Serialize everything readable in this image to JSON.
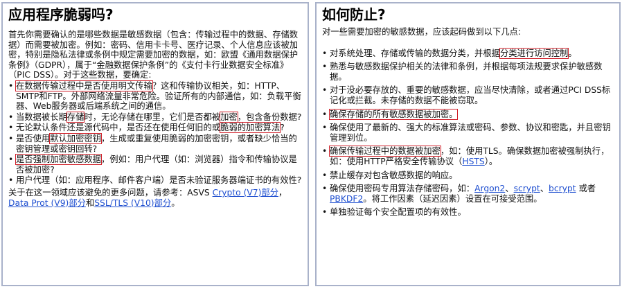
{
  "left": {
    "title": "应用程序脆弱吗?",
    "intro": "首先你需要确认的是哪些数据是敏感数据（包含：传输过程中的数据、存储数据）而需要被加密。例如：密码、信用卡卡号、医疗记录、个人信息应该被加密，特别是隐私法律或条例中规定需要加密的数据，如：欧盟《通用数据保护条例》（GDPR），属于“金融数据保护条例”的《支付卡行业数据安全标准》（PIC DSS）。对于这些数据，要确定:",
    "items": [
      {
        "pre": "",
        "box": "在数据传输过程中是否使用明文传输",
        "post": "？这和传输协议相关，如：HTTP、SMTP和FTP。外部网络流量非常危险。验证所有的内部通信，如：负载平衡器、Web服务器或后端系统之间的通信。"
      },
      {
        "pre": "当数据被长期",
        "box": "存储",
        "mid": "时，无论存储在哪里，它们是否都被",
        "box2": "加密",
        "post": "，包含备份数据?"
      },
      {
        "pre": "无论默认条件还是源代码中，是否还在使用任何旧的或",
        "box": "脆弱的加密算法",
        "post": "?"
      },
      {
        "pre": "是否使用",
        "box": "默认加密密钥",
        "post": "，生成或重复使用脆弱的加密密钥，或者缺少恰当的密钥管理或密钥回转?"
      },
      {
        "pre": "",
        "box": "是否强制加密敏感数据",
        "post": "，例如：用户代理（如：浏览器）指令和传输协议是否被加密?"
      },
      {
        "pre": "用户代理（如：应用程序、邮件客户端）是否未验证服务器端证书的有效性?",
        "box": "",
        "post": ""
      }
    ],
    "outro_text1": "关于在这一领域应该避免的更多问题，请参考：ASVS ",
    "outro_link1": "Crypto (V7)部分",
    "outro_text2": "，",
    "outro_link2": "Data Prot (V9)部分",
    "outro_text3": "和",
    "outro_link3": "SSL/TLS (V10)部分",
    "outro_text4": "。"
  },
  "right": {
    "title": "如何防止?",
    "intro": "对一些需要加密的敏感数据，应该起码做到以下几点:",
    "items": [
      {
        "pre": "对系统处理、存储或传输的数据分类，并根据",
        "box": "分类进行访问控制",
        "post": "。"
      },
      {
        "pre": "熟悉与敏感数据保护相关的法律和条例，并根据每项法规要求保护敏感数据。",
        "box": "",
        "post": ""
      },
      {
        "pre": "对于没必要存放的、重要的敏感数据，应当尽快清除，或者通过PCI DSS标记化或拦截。未存储的数据不能被窃取。",
        "box": "",
        "post": ""
      },
      {
        "pre": "",
        "box": "确保存储的所有敏感数据被加密。",
        "post": ""
      },
      {
        "pre": "确保使用了最新的、强大的标准算法或密码、参数、协议和密匙，并且密钥管理到位。",
        "box": "",
        "post": ""
      },
      {
        "pre": "",
        "box": "确保传输过程中的数据被加密",
        "post": "，如：使用TLS。确保数据加密被强制执行，如：使用HTTP严格安全传输协议（",
        "link": "HSTS",
        "post2": "）。"
      },
      {
        "pre": "禁止缓存对包含敏感数据的响应。",
        "box": "",
        "post": ""
      },
      {
        "pre": "确保使用密码专用算法存储密码，如：",
        "link": "Argon2",
        "mid": "、",
        "link2": "scrypt",
        "mid2": "、",
        "link3": "bcrypt",
        "mid3": " 或者",
        "link4": "PBKDF2",
        "post": "。将工作因素（延迟因素）设置在可接受范围。"
      },
      {
        "pre": "单独验证每个安全配置项的有效性。",
        "box": "",
        "post": ""
      }
    ]
  }
}
